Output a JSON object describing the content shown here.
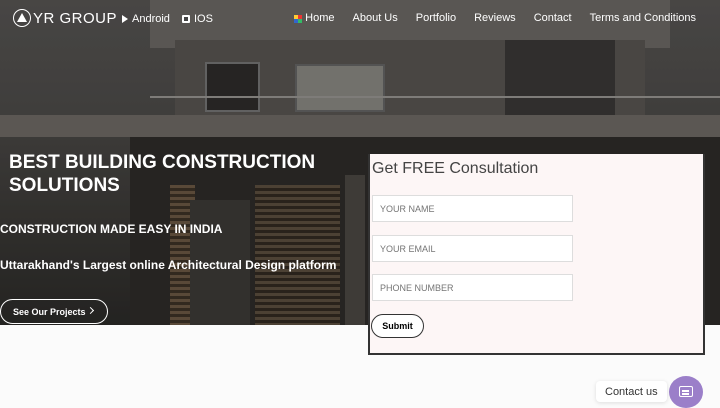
{
  "nav": {
    "brand": "YR GROUP",
    "android": "Android",
    "ios": "IOS",
    "menu": [
      "Home",
      "About Us",
      "Portfolio",
      "Reviews",
      "Contact",
      "Terms and Conditions"
    ]
  },
  "hero": {
    "title": "BEST BUILDING CONSTRUCTION SOLUTIONS",
    "tagline": "CONSTRUCTION MADE EASY IN INDIA",
    "subtitle": "Uttarakhand's Largest online Architectural Design platform",
    "cta": "See Our Projects"
  },
  "form": {
    "title": "Get FREE Consultation",
    "name_placeholder": "YOUR NAME",
    "email_placeholder": "YOUR EMAIL",
    "phone_placeholder": "PHONE NUMBER",
    "submit": "Submit"
  },
  "contact_widget": {
    "label": "Contact us"
  },
  "colors": {
    "accent": "#9b7fc9",
    "form_bg": "#fdf6f6"
  },
  "icons": [
    "logo-icon",
    "android-icon",
    "apple-icon",
    "google-icon",
    "chevron-right-icon",
    "chat-icon"
  ]
}
